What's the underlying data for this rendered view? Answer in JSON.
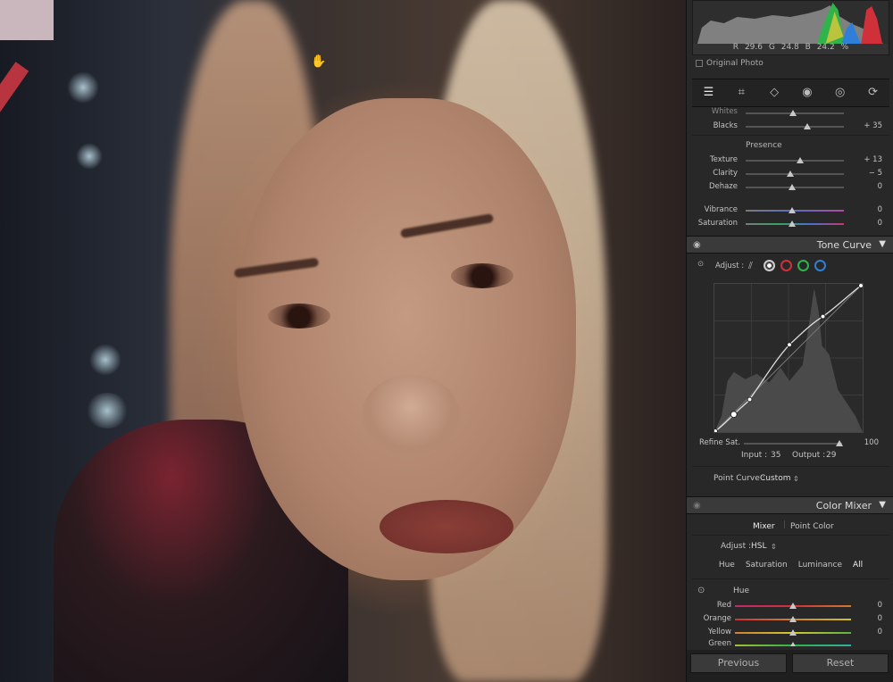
{
  "histogram": {
    "r_label": "R",
    "r_value": "29.6",
    "g_label": "G",
    "g_value": "24.8",
    "b_label": "B",
    "b_value": "24.2",
    "percent": "%",
    "original_photo": "Original Photo"
  },
  "basic": {
    "whites_label": "Whites",
    "blacks_label": "Blacks",
    "blacks_value": "+ 35",
    "presence_title": "Presence",
    "texture_label": "Texture",
    "texture_value": "+ 13",
    "clarity_label": "Clarity",
    "clarity_value": "− 5",
    "dehaze_label": "Dehaze",
    "dehaze_value": "0",
    "vibrance_label": "Vibrance",
    "vibrance_value": "0",
    "saturation_label": "Saturation",
    "saturation_value": "0"
  },
  "tone_curve": {
    "title": "Tone Curve",
    "adjust_label": "Adjust :",
    "refine_label": "Refine Sat.",
    "refine_value": "100",
    "input_label": "Input :",
    "input_value": "35",
    "output_label": "Output :",
    "output_value": "29",
    "point_curve_label": "Point Curve :",
    "point_curve_value": "Custom"
  },
  "color_mixer": {
    "title": "Color Mixer",
    "tab_mixer": "Mixer",
    "tab_point_color": "Point Color",
    "adjust_label": "Adjust :",
    "adjust_value": "HSL",
    "sub_hue": "Hue",
    "sub_saturation": "Saturation",
    "sub_luminance": "Luminance",
    "sub_all": "All",
    "hue_title": "Hue",
    "red_label": "Red",
    "red_value": "0",
    "orange_label": "Orange",
    "orange_value": "0",
    "yellow_label": "Yellow",
    "yellow_value": "0",
    "green_label": "Green"
  },
  "footer": {
    "previous": "Previous",
    "reset": "Reset"
  },
  "colors": {
    "panel_bg": "#282828",
    "header_bg": "#3a3a3a",
    "curve_red": "#d0303a",
    "curve_green": "#2fb34a",
    "curve_blue": "#2f7fd8"
  }
}
